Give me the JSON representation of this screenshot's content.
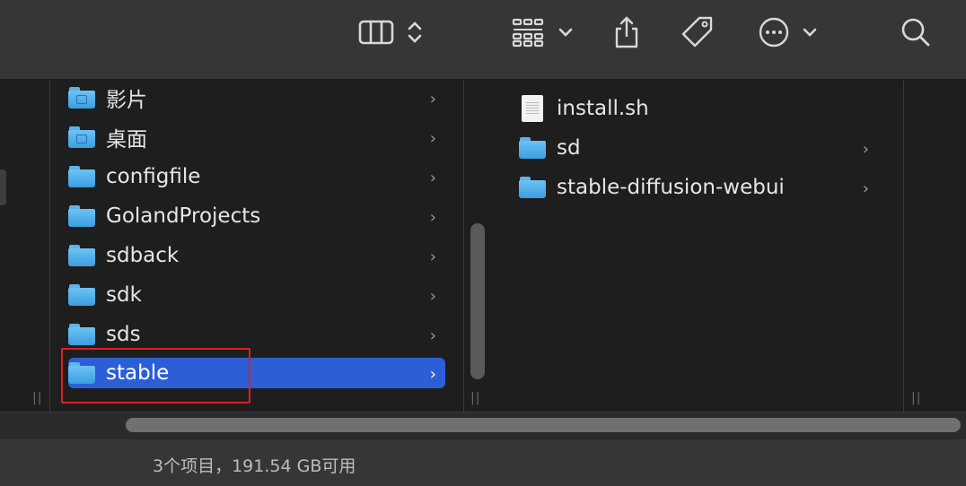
{
  "toolbar": {
    "view_mode_icon": "columns-view-icon",
    "view_mode_stepper_icon": "up-down-chevron-icon",
    "group_icon": "grid-group-icon",
    "group_chevron_icon": "chevron-down-icon",
    "share_icon": "share-icon",
    "tag_icon": "tag-icon",
    "more_icon": "ellipsis-circle-icon",
    "more_chevron_icon": "chevron-down-icon",
    "search_icon": "search-icon"
  },
  "column1": {
    "items": [
      {
        "label": "影片",
        "kind": "movies-folder",
        "has_children": true,
        "selected": false
      },
      {
        "label": "桌面",
        "kind": "desktop-folder",
        "has_children": true,
        "selected": false
      },
      {
        "label": "configfile",
        "kind": "folder",
        "has_children": true,
        "selected": false
      },
      {
        "label": "GolandProjects",
        "kind": "folder",
        "has_children": true,
        "selected": false
      },
      {
        "label": "sdback",
        "kind": "folder",
        "has_children": true,
        "selected": false
      },
      {
        "label": "sdk",
        "kind": "folder",
        "has_children": true,
        "selected": false
      },
      {
        "label": "sds",
        "kind": "folder",
        "has_children": true,
        "selected": false
      },
      {
        "label": "stable",
        "kind": "folder",
        "has_children": true,
        "selected": true
      }
    ]
  },
  "column2": {
    "items": [
      {
        "label": "install.sh",
        "kind": "file",
        "has_children": false
      },
      {
        "label": "sd",
        "kind": "folder",
        "has_children": true
      },
      {
        "label": "stable-diffusion-webui",
        "kind": "folder",
        "has_children": true
      }
    ]
  },
  "chevron_glyph": "›",
  "grip_glyph": "||",
  "status": {
    "text": "3个项目，191.54 GB可用"
  },
  "colors": {
    "selection": "#2c5fd6",
    "highlight_box": "#d9211f",
    "folder": "#5fb1ea"
  }
}
